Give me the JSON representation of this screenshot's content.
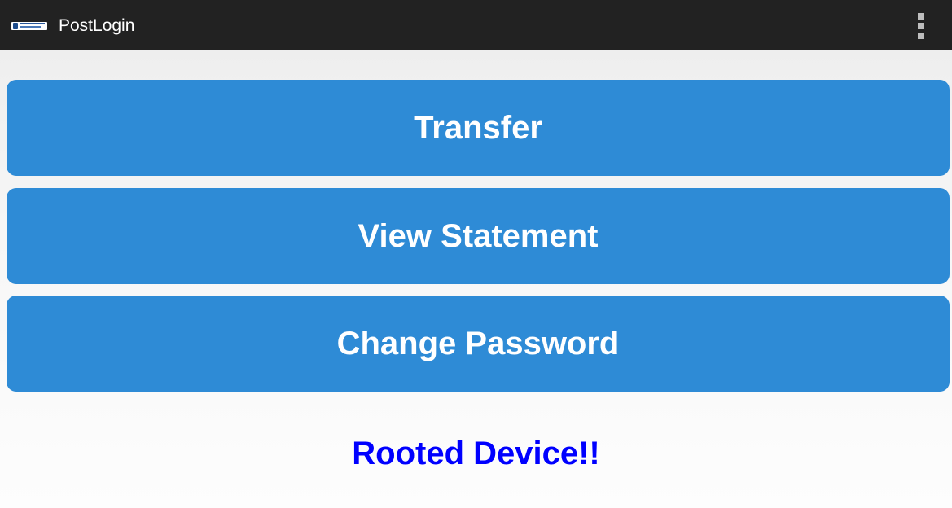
{
  "action_bar": {
    "title": "PostLogin",
    "app_icon": "bank-logo-icon",
    "overflow_icon": "overflow-menu-icon"
  },
  "buttons": {
    "transfer": "Transfer",
    "view_statement": "View Statement",
    "change_password": "Change Password"
  },
  "status": {
    "message": "Rooted Device!!"
  },
  "colors": {
    "action_bar": "#222222",
    "button": "#2e8bd6",
    "button_text": "#ffffff",
    "status_text": "#0000ff"
  }
}
